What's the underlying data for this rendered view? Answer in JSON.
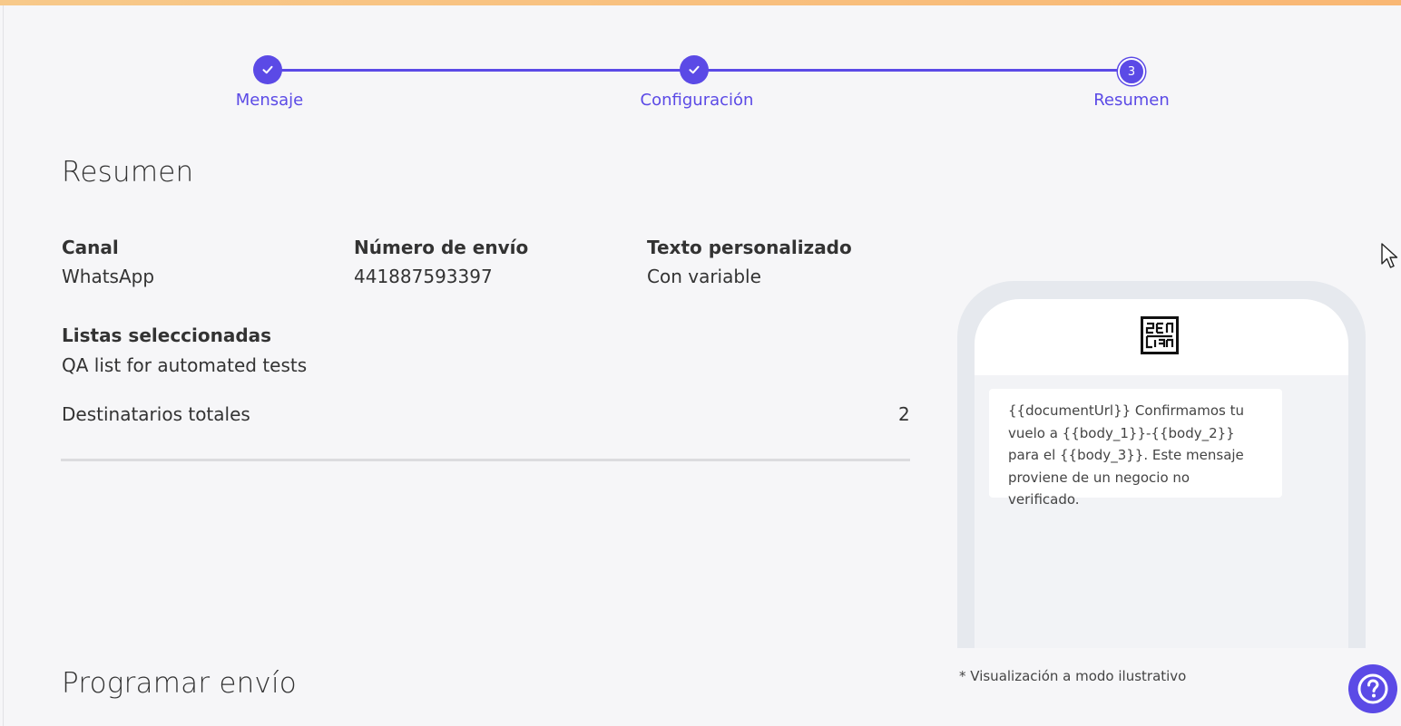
{
  "stepper": {
    "steps": [
      {
        "label": "Mensaje",
        "state": "done"
      },
      {
        "label": "Configuración",
        "state": "done"
      },
      {
        "label": "Resumen",
        "state": "current",
        "number": "3"
      }
    ]
  },
  "summary": {
    "title": "Resumen",
    "canal_label": "Canal",
    "canal_value": "WhatsApp",
    "numero_label": "Número de envío",
    "numero_value": "441887593397",
    "texto_label": "Texto personalizado",
    "texto_value": "Con variable",
    "listas_label": "Listas seleccionadas",
    "listas_value": "QA list for automated tests",
    "destinatarios_label": "Destinatarios totales",
    "destinatarios_value": "2"
  },
  "preview": {
    "message": "{{documentUrl}} Confirmamos tu vuelo a {{body_1}}-{{body_2}} para el {{body_3}}. Este mensaje proviene de un negocio no verificado.",
    "disclaimer": "* Visualización a modo ilustrativo"
  },
  "schedule": {
    "title": "Programar envío"
  },
  "colors": {
    "accent": "#5b4ae6",
    "top_bar": "#f9b774"
  },
  "icons": {
    "check": "check-icon",
    "help": "question-mark-icon",
    "cursor": "mouse-pointer-icon"
  }
}
